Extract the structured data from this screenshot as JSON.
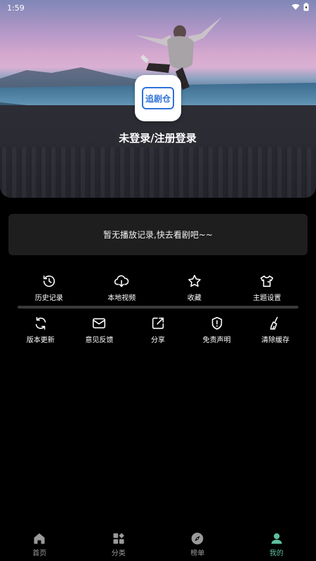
{
  "status_bar": {
    "time": "1:59"
  },
  "hero": {
    "logo_text": "追剧仓",
    "login_label": "未登录/注册登录"
  },
  "history": {
    "empty_text": "暂无播放记录,快去看剧吧~~"
  },
  "row1": [
    {
      "label": "历史记录",
      "icon": "history-icon"
    },
    {
      "label": "本地视频",
      "icon": "cloud-download-icon"
    },
    {
      "label": "收藏",
      "icon": "star-icon"
    },
    {
      "label": "主题设置",
      "icon": "tshirt-icon"
    }
  ],
  "row2": [
    {
      "label": "版本更新",
      "icon": "refresh-icon"
    },
    {
      "label": "意见反馈",
      "icon": "mail-icon"
    },
    {
      "label": "分享",
      "icon": "share-icon"
    },
    {
      "label": "免责声明",
      "icon": "shield-alert-icon"
    },
    {
      "label": "清除缓存",
      "icon": "broom-icon"
    }
  ],
  "nav": [
    {
      "label": "首页",
      "icon": "home-icon"
    },
    {
      "label": "分类",
      "icon": "category-icon"
    },
    {
      "label": "榜单",
      "icon": "compass-icon"
    },
    {
      "label": "我的",
      "icon": "user-icon",
      "active": true
    }
  ],
  "colors": {
    "accent": "#5fbf9f",
    "card_bg": "#1e1e1e",
    "logo_blue": "#2f72d8"
  }
}
